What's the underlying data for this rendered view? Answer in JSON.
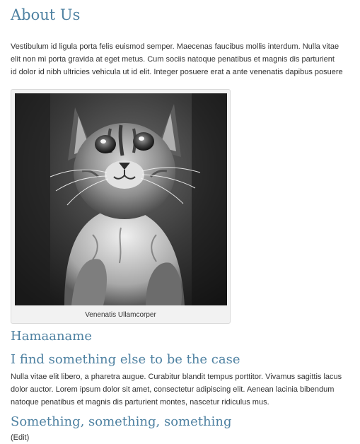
{
  "article": {
    "title": "About Us",
    "intro_lines": [
      "Vestibulum id ligula porta felis euismod semper. Maecenas faucibus mollis interdum. Nulla vitae",
      "elit non mi porta gravida at eget metus. Cum sociis natoque penatibus et magnis dis parturient",
      "id dolor id nibh ultricies vehicula ut id elit. Integer posuere erat a ante venenatis dapibus posuere"
    ],
    "figure": {
      "image_subject": "kitten-photo",
      "caption": "Venenatis Ullamcorper"
    },
    "heading_1": "Hamaaname",
    "heading_2": "I find something else to be the case",
    "section_lines": [
      "Nulla vitae elit libero, a pharetra augue. Curabitur blandit tempus porttitor. Vivamus sagittis lacus",
      "dolor auctor. Lorem ipsum dolor sit amet, consectetur adipiscing elit. Aenean lacinia bibendum",
      "natoque penatibus et magnis dis parturient montes, nascetur ridiculus mus."
    ],
    "heading_3": "Something, something, something",
    "trailing_text": "(Edit)"
  },
  "colors": {
    "heading": "#4f82a2",
    "body_text": "#333333",
    "figure_background": "#f2f2f2",
    "figure_border": "#dadada"
  }
}
